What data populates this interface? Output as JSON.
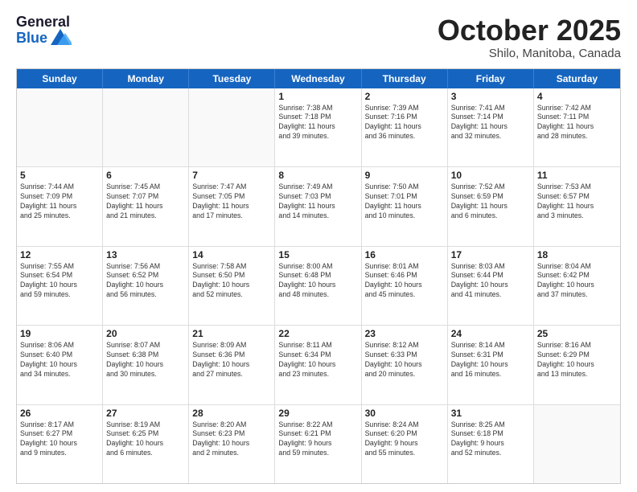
{
  "header": {
    "logo_general": "General",
    "logo_blue": "Blue",
    "title": "October 2025",
    "subtitle": "Shilo, Manitoba, Canada"
  },
  "days_of_week": [
    "Sunday",
    "Monday",
    "Tuesday",
    "Wednesday",
    "Thursday",
    "Friday",
    "Saturday"
  ],
  "weeks": [
    [
      {
        "day": "",
        "info": ""
      },
      {
        "day": "",
        "info": ""
      },
      {
        "day": "",
        "info": ""
      },
      {
        "day": "1",
        "info": "Sunrise: 7:38 AM\nSunset: 7:18 PM\nDaylight: 11 hours\nand 39 minutes."
      },
      {
        "day": "2",
        "info": "Sunrise: 7:39 AM\nSunset: 7:16 PM\nDaylight: 11 hours\nand 36 minutes."
      },
      {
        "day": "3",
        "info": "Sunrise: 7:41 AM\nSunset: 7:14 PM\nDaylight: 11 hours\nand 32 minutes."
      },
      {
        "day": "4",
        "info": "Sunrise: 7:42 AM\nSunset: 7:11 PM\nDaylight: 11 hours\nand 28 minutes."
      }
    ],
    [
      {
        "day": "5",
        "info": "Sunrise: 7:44 AM\nSunset: 7:09 PM\nDaylight: 11 hours\nand 25 minutes."
      },
      {
        "day": "6",
        "info": "Sunrise: 7:45 AM\nSunset: 7:07 PM\nDaylight: 11 hours\nand 21 minutes."
      },
      {
        "day": "7",
        "info": "Sunrise: 7:47 AM\nSunset: 7:05 PM\nDaylight: 11 hours\nand 17 minutes."
      },
      {
        "day": "8",
        "info": "Sunrise: 7:49 AM\nSunset: 7:03 PM\nDaylight: 11 hours\nand 14 minutes."
      },
      {
        "day": "9",
        "info": "Sunrise: 7:50 AM\nSunset: 7:01 PM\nDaylight: 11 hours\nand 10 minutes."
      },
      {
        "day": "10",
        "info": "Sunrise: 7:52 AM\nSunset: 6:59 PM\nDaylight: 11 hours\nand 6 minutes."
      },
      {
        "day": "11",
        "info": "Sunrise: 7:53 AM\nSunset: 6:57 PM\nDaylight: 11 hours\nand 3 minutes."
      }
    ],
    [
      {
        "day": "12",
        "info": "Sunrise: 7:55 AM\nSunset: 6:54 PM\nDaylight: 10 hours\nand 59 minutes."
      },
      {
        "day": "13",
        "info": "Sunrise: 7:56 AM\nSunset: 6:52 PM\nDaylight: 10 hours\nand 56 minutes."
      },
      {
        "day": "14",
        "info": "Sunrise: 7:58 AM\nSunset: 6:50 PM\nDaylight: 10 hours\nand 52 minutes."
      },
      {
        "day": "15",
        "info": "Sunrise: 8:00 AM\nSunset: 6:48 PM\nDaylight: 10 hours\nand 48 minutes."
      },
      {
        "day": "16",
        "info": "Sunrise: 8:01 AM\nSunset: 6:46 PM\nDaylight: 10 hours\nand 45 minutes."
      },
      {
        "day": "17",
        "info": "Sunrise: 8:03 AM\nSunset: 6:44 PM\nDaylight: 10 hours\nand 41 minutes."
      },
      {
        "day": "18",
        "info": "Sunrise: 8:04 AM\nSunset: 6:42 PM\nDaylight: 10 hours\nand 37 minutes."
      }
    ],
    [
      {
        "day": "19",
        "info": "Sunrise: 8:06 AM\nSunset: 6:40 PM\nDaylight: 10 hours\nand 34 minutes."
      },
      {
        "day": "20",
        "info": "Sunrise: 8:07 AM\nSunset: 6:38 PM\nDaylight: 10 hours\nand 30 minutes."
      },
      {
        "day": "21",
        "info": "Sunrise: 8:09 AM\nSunset: 6:36 PM\nDaylight: 10 hours\nand 27 minutes."
      },
      {
        "day": "22",
        "info": "Sunrise: 8:11 AM\nSunset: 6:34 PM\nDaylight: 10 hours\nand 23 minutes."
      },
      {
        "day": "23",
        "info": "Sunrise: 8:12 AM\nSunset: 6:33 PM\nDaylight: 10 hours\nand 20 minutes."
      },
      {
        "day": "24",
        "info": "Sunrise: 8:14 AM\nSunset: 6:31 PM\nDaylight: 10 hours\nand 16 minutes."
      },
      {
        "day": "25",
        "info": "Sunrise: 8:16 AM\nSunset: 6:29 PM\nDaylight: 10 hours\nand 13 minutes."
      }
    ],
    [
      {
        "day": "26",
        "info": "Sunrise: 8:17 AM\nSunset: 6:27 PM\nDaylight: 10 hours\nand 9 minutes."
      },
      {
        "day": "27",
        "info": "Sunrise: 8:19 AM\nSunset: 6:25 PM\nDaylight: 10 hours\nand 6 minutes."
      },
      {
        "day": "28",
        "info": "Sunrise: 8:20 AM\nSunset: 6:23 PM\nDaylight: 10 hours\nand 2 minutes."
      },
      {
        "day": "29",
        "info": "Sunrise: 8:22 AM\nSunset: 6:21 PM\nDaylight: 9 hours\nand 59 minutes."
      },
      {
        "day": "30",
        "info": "Sunrise: 8:24 AM\nSunset: 6:20 PM\nDaylight: 9 hours\nand 55 minutes."
      },
      {
        "day": "31",
        "info": "Sunrise: 8:25 AM\nSunset: 6:18 PM\nDaylight: 9 hours\nand 52 minutes."
      },
      {
        "day": "",
        "info": ""
      }
    ]
  ]
}
